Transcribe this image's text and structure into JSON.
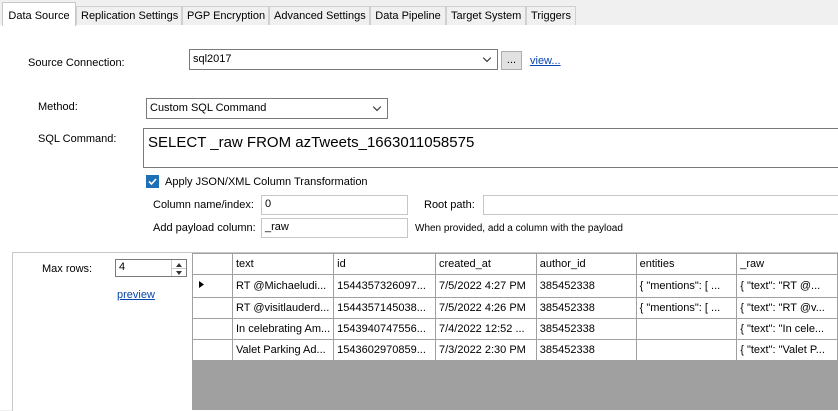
{
  "tabs": [
    {
      "label": "Data Source",
      "active": true
    },
    {
      "label": "Replication Settings",
      "active": false
    },
    {
      "label": "PGP Encryption",
      "active": false
    },
    {
      "label": "Advanced Settings",
      "active": false
    },
    {
      "label": "Data Pipeline",
      "active": false
    },
    {
      "label": "Target System",
      "active": false
    },
    {
      "label": "Triggers",
      "active": false
    }
  ],
  "source": {
    "label": "Source Connection:",
    "value": "sql2017",
    "browse_label": "...",
    "view_label": "view..."
  },
  "method": {
    "label": "Method:",
    "value": "Custom SQL Command"
  },
  "sql": {
    "label": "SQL Command:",
    "value": "SELECT _raw FROM azTweets_1663011058575"
  },
  "transform": {
    "checkbox_label": "Apply JSON/XML Column Transformation",
    "checked": true,
    "column_label": "Column name/index:",
    "column_value": "0",
    "root_label": "Root path:",
    "root_value": "",
    "payload_label": "Add payload column:",
    "payload_value": "_raw",
    "payload_hint": "When provided, add a column with the payload"
  },
  "preview": {
    "max_rows_label": "Max rows:",
    "max_rows_value": "4",
    "preview_link": "preview"
  },
  "grid": {
    "columns": [
      "text",
      "id",
      "created_at",
      "author_id",
      "entities",
      "_raw"
    ],
    "rows": [
      [
        "RT @Michaeludi...",
        "1544357326097...",
        "7/5/2022 4:27 PM",
        "385452338",
        "{  \"mentions\": [   ...",
        "{  \"text\": \"RT @..."
      ],
      [
        "RT @visitlauderd...",
        "1544357145038...",
        "7/5/2022 4:26 PM",
        "385452338",
        "{  \"mentions\": [   ...",
        "{  \"text\": \"RT @v..."
      ],
      [
        "In celebrating Am...",
        "1543940747556...",
        "7/4/2022 12:52 ...",
        "385452338",
        "",
        "{  \"text\": \"In cele..."
      ],
      [
        "Valet Parking Ad...",
        "1543602970859...",
        "7/3/2022 2:30 PM",
        "385452338",
        "",
        "{  \"text\": \"Valet P..."
      ]
    ]
  }
}
